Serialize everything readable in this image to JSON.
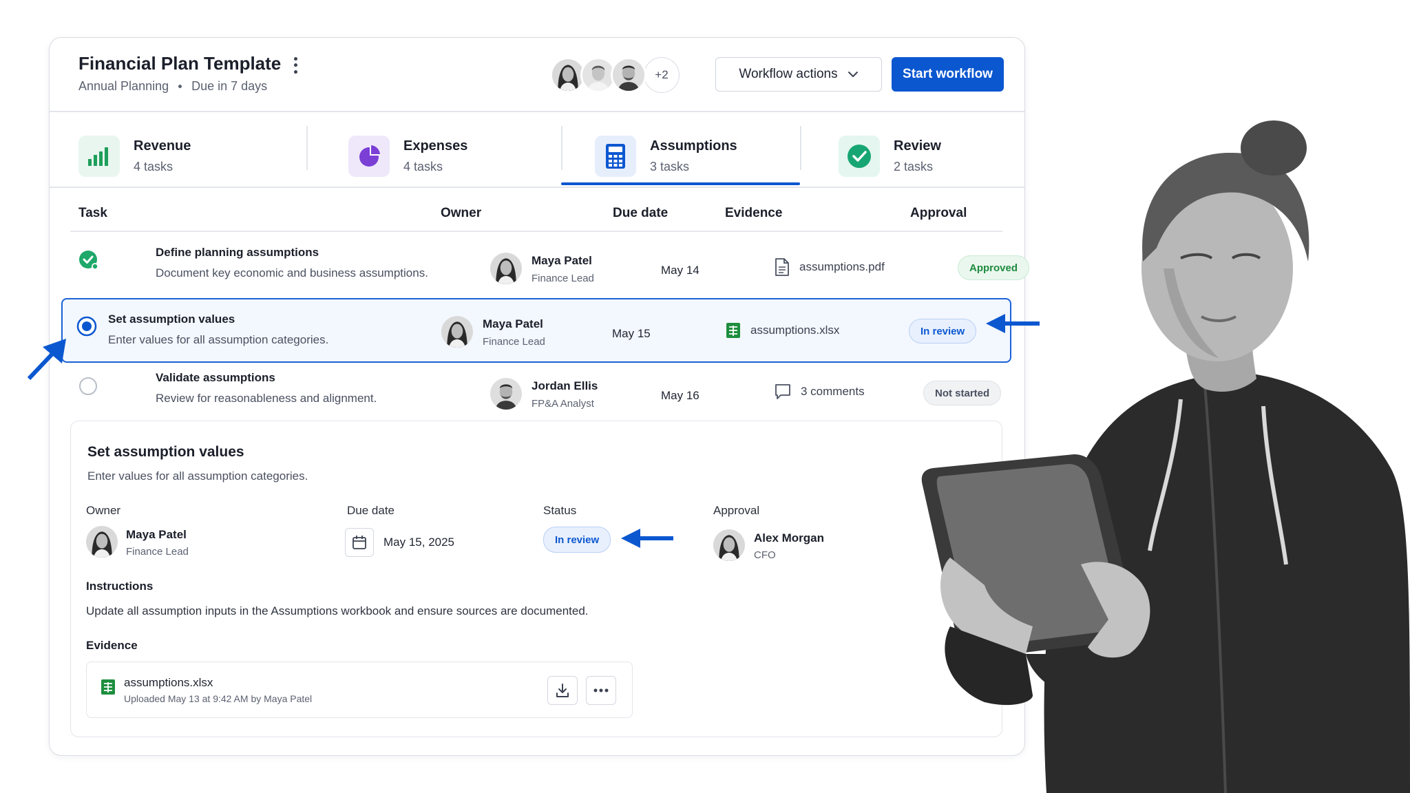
{
  "header": {
    "title": "Financial Plan Template",
    "subtitle_project": "Annual Planning",
    "subtitle_due": "Due in 7 days",
    "more_collaborators": "+2",
    "workflow_actions_label": "Workflow actions",
    "start_workflow_label": "Start workflow"
  },
  "tabs": [
    {
      "label": "Revenue",
      "count": "4 tasks",
      "icon": "bar-chart-icon",
      "color": "#1e9e5a"
    },
    {
      "label": "Expenses",
      "count": "4 tasks",
      "icon": "pie-chart-icon",
      "color": "#7b3fd6"
    },
    {
      "label": "Assumptions",
      "count": "3 tasks",
      "icon": "calculator-icon",
      "color": "#0b57d0"
    },
    {
      "label": "Review",
      "count": "2 tasks",
      "icon": "check-circle-icon",
      "color": "#17a673"
    }
  ],
  "active_tab": "Assumptions",
  "table": {
    "headers": [
      "Task",
      "Owner",
      "Due date",
      "Evidence",
      "Approval"
    ],
    "rows": [
      {
        "title": "Define planning assumptions",
        "desc": "Document key economic and business assumptions.",
        "owner": "Maya Patel",
        "role": "Finance Lead",
        "due": "May 14",
        "evidence": "assumptions.pdf",
        "evidence_icon": "document-icon",
        "approval": "Approved",
        "state": "complete"
      },
      {
        "title": "Set assumption values",
        "desc": "Enter values for all assumption categories.",
        "owner": "Maya Patel",
        "role": "Finance Lead",
        "due": "May 15",
        "evidence": "assumptions.xlsx",
        "evidence_icon": "spreadsheet-icon",
        "approval": "In review",
        "state": "selected"
      },
      {
        "title": "Validate assumptions",
        "desc": "Review for reasonableness and alignment.",
        "owner": "Jordan Ellis",
        "role": "FP&A Analyst",
        "due": "May 16",
        "evidence": "3 comments",
        "evidence_icon": "comment-icon",
        "approval": "Not started",
        "state": "pending"
      }
    ]
  },
  "detail": {
    "title": "Set assumption values",
    "desc": "Enter values for all assumption categories.",
    "owner_label": "Owner",
    "owner_name": "Maya Patel",
    "owner_role": "Finance Lead",
    "due_label": "Due date",
    "due_value": "May 15, 2025",
    "status_label": "Status",
    "status_value": "In review",
    "approval_label": "Approval",
    "approver_name": "Alex Morgan",
    "approver_role": "CFO",
    "instructions_label": "Instructions",
    "instructions": "Update all assumption inputs in the Assumptions workbook and ensure sources are documented.",
    "evidence_label": "Evidence",
    "file_name": "assumptions.xlsx",
    "file_meta": "Uploaded May 13 at 9:42 AM by Maya Patel"
  },
  "colors": {
    "primary": "#0b57d0",
    "approved": "#1e8b3f",
    "review": "#0b57d0",
    "neutral": "#4a5060"
  }
}
